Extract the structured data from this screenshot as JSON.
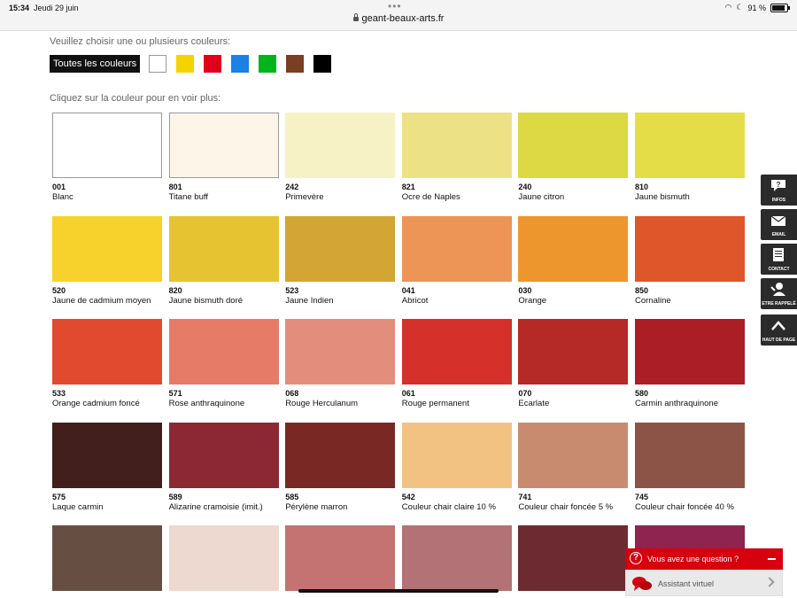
{
  "status_bar": {
    "time": "15:34",
    "date": "Jeudi 29 juin",
    "url": "geant-beaux-arts.fr",
    "battery": "91 %"
  },
  "filter": {
    "prompt": "Veuillez choisir une ou plusieurs couleurs:",
    "all_label": "Toutes les couleurs",
    "colors": [
      {
        "name": "white-filter",
        "color": "#ffffff"
      },
      {
        "name": "yellow-filter",
        "color": "#f5d300"
      },
      {
        "name": "red-filter",
        "color": "#e0001a"
      },
      {
        "name": "blue-filter",
        "color": "#1a82e2"
      },
      {
        "name": "green-filter",
        "color": "#00b51a"
      },
      {
        "name": "brown-filter",
        "color": "#7a3e22"
      },
      {
        "name": "black-filter",
        "color": "#000000"
      }
    ]
  },
  "grid_prompt": "Cliquez sur la couleur pour en voir plus:",
  "swatches": [
    {
      "code": "001",
      "name": "Blanc",
      "color": "#ffffff"
    },
    {
      "code": "801",
      "name": "Titane buff",
      "color": "#fdf6e8"
    },
    {
      "code": "242",
      "name": "Primevère",
      "color": "#f6f2c6"
    },
    {
      "code": "821",
      "name": "Ocre de Naples",
      "color": "#ede185"
    },
    {
      "code": "240",
      "name": "Jaune citron",
      "color": "#dcd944"
    },
    {
      "code": "810",
      "name": "Jaune bismuth",
      "color": "#e4dd48"
    },
    {
      "code": "520",
      "name": "Jaune de cadmium moyen",
      "color": "#f8d22c"
    },
    {
      "code": "820",
      "name": "Jaune bismuth doré",
      "color": "#e6c431"
    },
    {
      "code": "523",
      "name": "Jaune Indien",
      "color": "#d2a534"
    },
    {
      "code": "041",
      "name": "Abricot",
      "color": "#ed9457"
    },
    {
      "code": "030",
      "name": "Orange",
      "color": "#ec962d"
    },
    {
      "code": "850",
      "name": "Cornaline",
      "color": "#de5629"
    },
    {
      "code": "533",
      "name": "Orange cadmium foncé",
      "color": "#e24a30"
    },
    {
      "code": "571",
      "name": "Rose anthraquinone",
      "color": "#e67c68"
    },
    {
      "code": "068",
      "name": "Rouge Herculanum",
      "color": "#e38e7d"
    },
    {
      "code": "061",
      "name": "Rouge permanent",
      "color": "#d53029"
    },
    {
      "code": "070",
      "name": "Ecarlate",
      "color": "#b52926"
    },
    {
      "code": "580",
      "name": "Carmin anthraquinone",
      "color": "#ab1e26"
    },
    {
      "code": "575",
      "name": "Laque carmin",
      "color": "#421e1c"
    },
    {
      "code": "589",
      "name": "Alizarine cramoisie (imit.)",
      "color": "#8c2734"
    },
    {
      "code": "585",
      "name": "Pérylène marron",
      "color": "#7a2824"
    },
    {
      "code": "542",
      "name": "Couleur chair claire 10 %",
      "color": "#f2c283"
    },
    {
      "code": "741",
      "name": "Couleur chair foncée 5 %",
      "color": "#c98b6f"
    },
    {
      "code": "745",
      "name": "Couleur chair foncée 40 %",
      "color": "#8c5447"
    },
    {
      "code": "",
      "name": "",
      "color": "#674e43"
    },
    {
      "code": "",
      "name": "",
      "color": "#edd9d0"
    },
    {
      "code": "",
      "name": "",
      "color": "#c47272"
    },
    {
      "code": "",
      "name": "",
      "color": "#b37276"
    },
    {
      "code": "",
      "name": "",
      "color": "#6e2a31"
    },
    {
      "code": "",
      "name": "",
      "color": "#8f2450"
    }
  ],
  "side_buttons": [
    {
      "name": "infos-button",
      "label": "INFOS",
      "icon": "speech-bubble-question-icon"
    },
    {
      "name": "email-button",
      "label": "EMAIL",
      "icon": "envelope-icon"
    },
    {
      "name": "contact-button",
      "label": "CONTACT",
      "icon": "document-icon"
    },
    {
      "name": "callback-button",
      "label": "ETRE RAPPELÉ",
      "icon": "phone-person-icon"
    },
    {
      "name": "top-button",
      "label": "HAUT DE PAGE",
      "icon": "chevron-up-icon"
    }
  ],
  "chat": {
    "question": "Vous avez une question ?",
    "assistant": "Assistant virtuel"
  }
}
